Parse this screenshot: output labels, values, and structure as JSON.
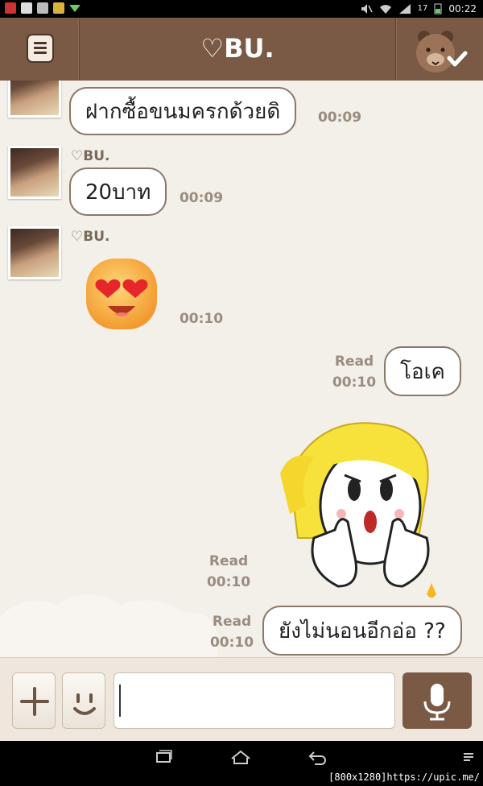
{
  "status_bar": {
    "time": "00:22",
    "battery": "17"
  },
  "header": {
    "title": "♡BU."
  },
  "messages": [
    {
      "from": "other",
      "sender": "",
      "text": "ฝากซื้อขนมครกด้วยดิ",
      "time": "00:09"
    },
    {
      "from": "other",
      "sender": "♡BU.",
      "text": "20บาท",
      "time": "00:09"
    },
    {
      "from": "other",
      "sender": "♡BU.",
      "sticker": "heart-eyes-emoji",
      "time": "00:10"
    },
    {
      "from": "me",
      "text": "โอเค",
      "read": "Read",
      "time": "00:10"
    },
    {
      "from": "me",
      "sticker": "thumbs-up-girl-sticker",
      "read": "Read",
      "time": "00:10"
    },
    {
      "from": "me",
      "text": "ยังไม่นอนอีกอ่อ ??",
      "read": "Read",
      "time": "00:10"
    }
  ],
  "input": {
    "placeholder": ""
  },
  "watermark": "[800x1280]https://upic.me/",
  "colors": {
    "header": "#7a5a45",
    "chat_bg": "#f3efe9",
    "bubble_border": "#8a7868",
    "meta": "#9a8d80"
  }
}
